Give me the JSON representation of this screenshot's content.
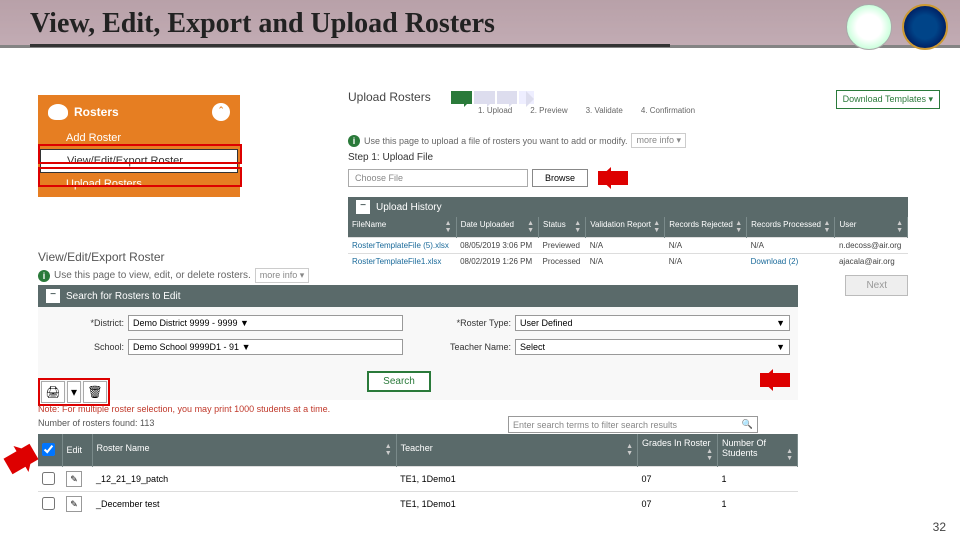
{
  "page": {
    "title": "View, Edit, Export and Upload Rosters",
    "number": "32"
  },
  "menu": {
    "header": "Rosters",
    "items": [
      "Add Roster",
      "View/Edit/Export Roster",
      "Upload Rosters"
    ]
  },
  "viewSection": {
    "heading": "View/Edit/Export Roster",
    "info": "Use this page to view, edit, or delete rosters.",
    "more": "more info ▾"
  },
  "search": {
    "header": "Search for Rosters to Edit",
    "fields": {
      "districtLabel": "*District:",
      "districtValue": "Demo District 9999 - 9999 ▼",
      "rosterTypeLabel": "*Roster Type:",
      "rosterTypeValue": "User Defined",
      "schoolLabel": "School:",
      "schoolValue": "Demo School 9999D1 - 91 ▼",
      "teacherLabel": "Teacher Name:",
      "teacherValue": "Select"
    },
    "button": "Search"
  },
  "note": "Note: For multiple roster selection, you may print 1000 students at a time.",
  "found": "Number of rosters found: 113",
  "filter": {
    "placeholder": "Enter search terms to filter search results"
  },
  "resultsTable": {
    "headers": {
      "edit": "Edit",
      "name": "Roster Name",
      "teacher": "Teacher",
      "grades": "Grades In Roster",
      "count": "Number Of Students"
    },
    "rows": [
      {
        "name": "_12_21_19_patch",
        "teacher": "TE1, 1Demo1",
        "grades": "07",
        "count": "1"
      },
      {
        "name": "_December test",
        "teacher": "TE1, 1Demo1",
        "grades": "07",
        "count": "1"
      }
    ]
  },
  "upload": {
    "title": "Upload Rosters",
    "steps": [
      "1. Upload",
      "2. Preview",
      "3. Validate",
      "4. Confirmation"
    ],
    "dlTemplates": "Download Templates ▾",
    "info": "Use this page to upload a file of rosters you want to add or modify.",
    "more": "more info ▾",
    "stepLabel": "Step 1: Upload File",
    "choosePlaceholder": "Choose File",
    "browse": "Browse",
    "historyHeader": "Upload History",
    "historyCols": {
      "file": "FileName",
      "date": "Date Uploaded",
      "status": "Status",
      "report": "Validation Report",
      "rejected": "Records Rejected",
      "processed": "Records Processed",
      "user": "User"
    },
    "historyRows": [
      {
        "file": "RosterTemplateFile (5).xlsx",
        "date": "08/05/2019 3:06 PM",
        "status": "Previewed",
        "report": "N/A",
        "rejected": "N/A",
        "processed": "N/A",
        "user": "n.decoss@air.org"
      },
      {
        "file": "RosterTemplateFile1.xlsx",
        "date": "08/02/2019 1:26 PM",
        "status": "Processed",
        "report": "N/A",
        "rejected": "N/A",
        "processed": "Download (2)",
        "user": "ajacala@air.org"
      }
    ],
    "next": "Next"
  }
}
